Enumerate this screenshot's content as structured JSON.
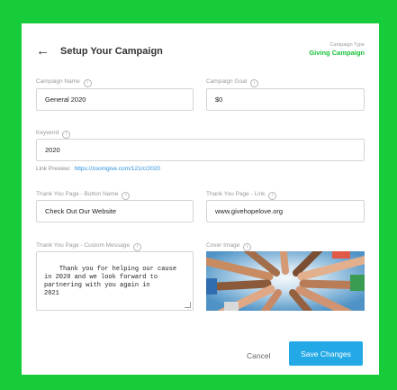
{
  "header": {
    "title": "Setup Your Campaign",
    "campaign_type_label": "Campaign Type",
    "campaign_type_value": "Giving Campaign"
  },
  "form": {
    "campaign_name": {
      "label": "Campaign Name",
      "value": "General 2020"
    },
    "campaign_goal": {
      "label": "Campaign Goal",
      "value": "$0"
    },
    "keyword": {
      "label": "Keyword",
      "value": "2020"
    },
    "link_preview": {
      "label": "Link Preview:",
      "value": "https://zoomgive.com/121/c/2020"
    },
    "ty_button_name": {
      "label": "Thank You Page - Button Name",
      "value": "Check Out Our Website"
    },
    "ty_link": {
      "label": "Thank You Page - Link",
      "value": "www.givehopelove.org"
    },
    "ty_message": {
      "label": "Thank You Page - Custom Message",
      "value": "Thank you for helping our cause\nin 2020 and we look forward to\npartnering with you again in\n2021"
    },
    "cover_image": {
      "label": "Cover Image"
    }
  },
  "actions": {
    "cancel_label": "Cancel",
    "save_label": "Save Changes"
  },
  "icons": {
    "back": "arrow-left-icon",
    "info": "info-icon"
  },
  "colors": {
    "background": "#16cc3a",
    "accent_green": "#18c23a",
    "primary_button": "#23a9e6",
    "link": "#2d8ed8"
  }
}
